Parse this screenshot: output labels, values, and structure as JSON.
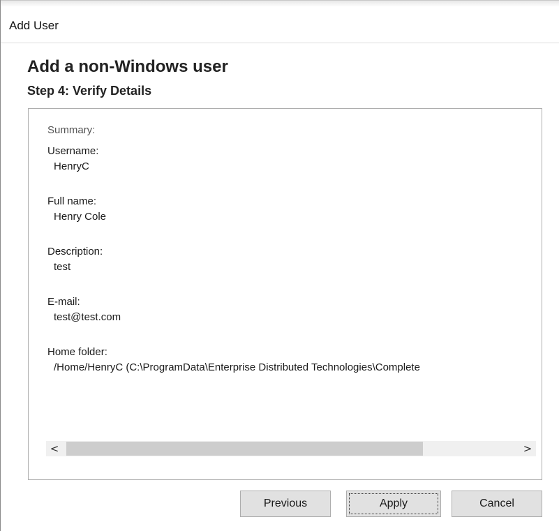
{
  "window": {
    "title": "Add User"
  },
  "wizard": {
    "heading": "Add a non-Windows user",
    "step": "Step 4: Verify Details"
  },
  "summary": {
    "label": "Summary:",
    "fields": [
      {
        "label": "Username:",
        "value": "HenryC"
      },
      {
        "label": "Full name:",
        "value": "Henry Cole"
      },
      {
        "label": "Description:",
        "value": "test"
      },
      {
        "label": "E-mail:",
        "value": "test@test.com"
      },
      {
        "label": "Home folder:",
        "value": "/Home/HenryC (C:\\ProgramData\\Enterprise Distributed Technologies\\Complete"
      }
    ]
  },
  "scrollbar": {
    "left_arrow": "<",
    "right_arrow": ">"
  },
  "buttons": {
    "previous": "Previous",
    "apply": "Apply",
    "cancel": "Cancel"
  },
  "icons": {
    "scroll_left": "chevron-left-icon",
    "scroll_right": "chevron-right-icon"
  }
}
